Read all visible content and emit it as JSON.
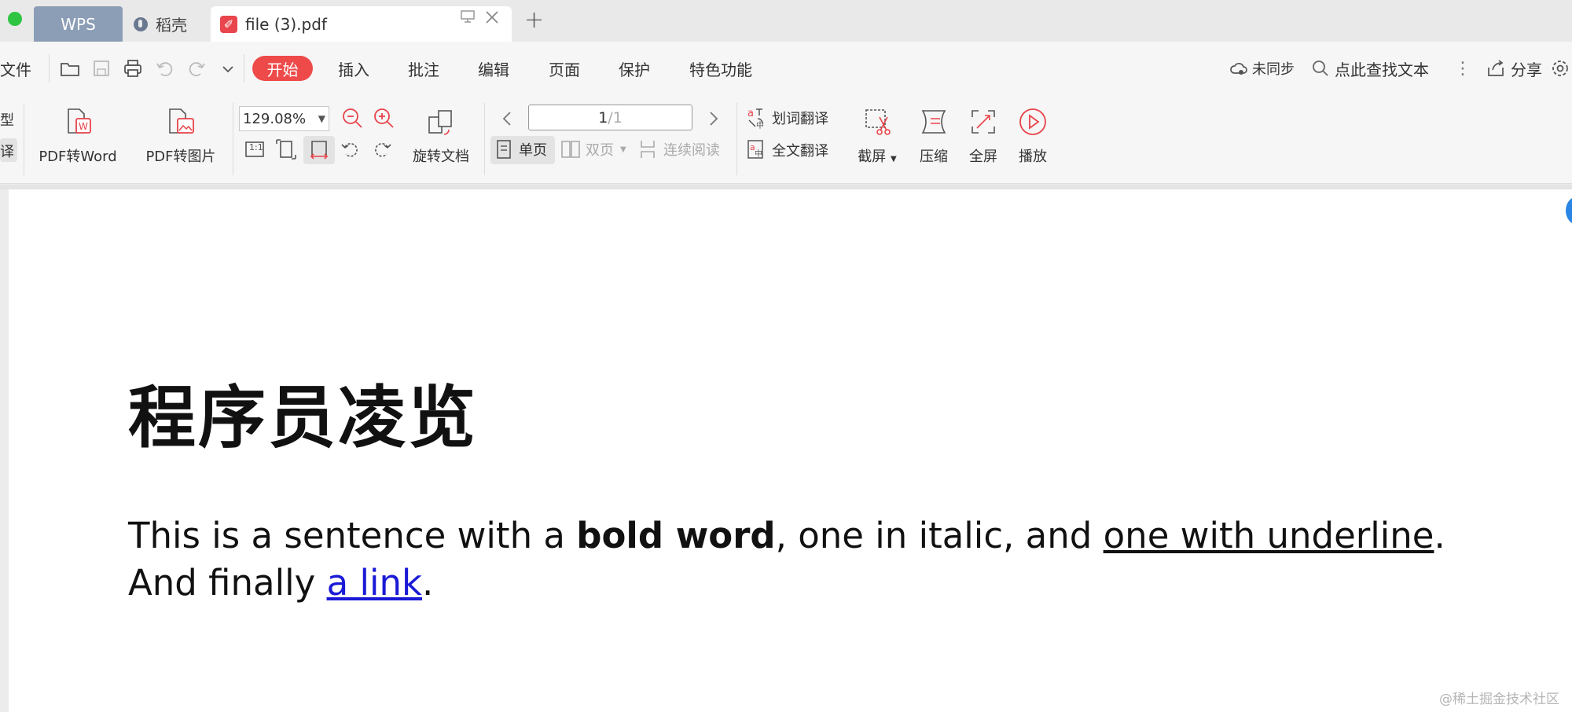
{
  "tabs": {
    "wps": "WPS",
    "daoke": "稻壳",
    "file": "file (3).pdf",
    "new": "+"
  },
  "menubar": {
    "file": "文件",
    "tabs": [
      "开始",
      "插入",
      "批注",
      "编辑",
      "页面",
      "保护",
      "特色功能"
    ],
    "sync": "未同步",
    "search": "点此查找文本",
    "share": "分享"
  },
  "ribbon": {
    "left_partial_1": "型",
    "left_partial_2": "译",
    "pdf_to_word": "PDF转Word",
    "pdf_to_image": "PDF转图片",
    "zoom": "129.08%",
    "rotate_doc": "旋转文档",
    "page_current": "1",
    "page_total": "/1",
    "single_page": "单页",
    "double_page": "双页",
    "continuous": "连续阅读",
    "word_translate": "划词翻译",
    "full_translate": "全文翻译",
    "screenshot": "截屏",
    "compress": "压缩",
    "fullscreen": "全屏",
    "play": "播放",
    "actual_size_label": "1:1"
  },
  "document": {
    "heading": "程序员凌览",
    "p_1": "This is a sentence with a ",
    "p_bold": "bold word",
    "p_2": ", one in italic, and ",
    "p_underline": "one with underline",
    "p_3": ". And finally ",
    "p_link": "a link",
    "p_4": "."
  },
  "watermark": "@稀土掘金技术社区",
  "colors": {
    "accent": "#ee4a4a",
    "tab_wps": "#8c9db6",
    "link": "#1a1ad6"
  }
}
